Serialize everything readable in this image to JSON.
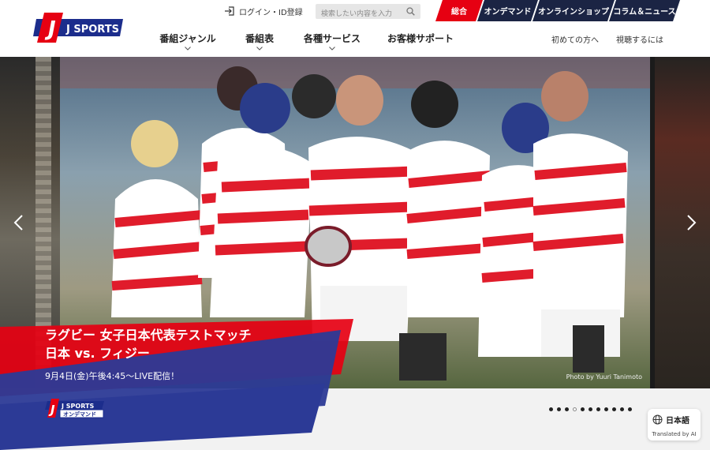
{
  "brand": {
    "logo_text": "J SPORTS",
    "accent": "#e60012",
    "navy": "#1b2444",
    "logo_blue": "#1c2d8c"
  },
  "header": {
    "login_label": "ログイン・ID登録",
    "search_placeholder": "検索したい内容を入力",
    "tabs": [
      {
        "label": "総合",
        "active": true
      },
      {
        "label": "オンデマンド",
        "active": false
      },
      {
        "label": "オンラインショップ",
        "active": false
      },
      {
        "label": "コラム＆ニュース",
        "active": false
      }
    ],
    "nav": [
      {
        "label": "番組ジャンル",
        "has_dropdown": true
      },
      {
        "label": "番組表",
        "has_dropdown": true
      },
      {
        "label": "各種サービス",
        "has_dropdown": true
      },
      {
        "label": "お客様サポート",
        "has_dropdown": false
      }
    ],
    "sublinks": [
      "初めての方へ",
      "視聴するには"
    ]
  },
  "hero": {
    "headline_line1": "ラグビー 女子日本代表テストマッチ",
    "headline_line2": "日本 vs. フィジー",
    "subline": "9月4日(金)午後4:45～LIVE配信！",
    "photo_credit": "Photo by Yuuri Tanimoto",
    "badge_logo_text": "J SPORTS",
    "badge_service_text": "オンデマンド",
    "prev_icon": "chevron-left-icon",
    "next_icon": "chevron-right-icon"
  },
  "carousel": {
    "dot_count": 11,
    "active_index": 2
  },
  "translate": {
    "language": "日本語",
    "caption": "Translated by AI",
    "icon": "globe-icon"
  }
}
